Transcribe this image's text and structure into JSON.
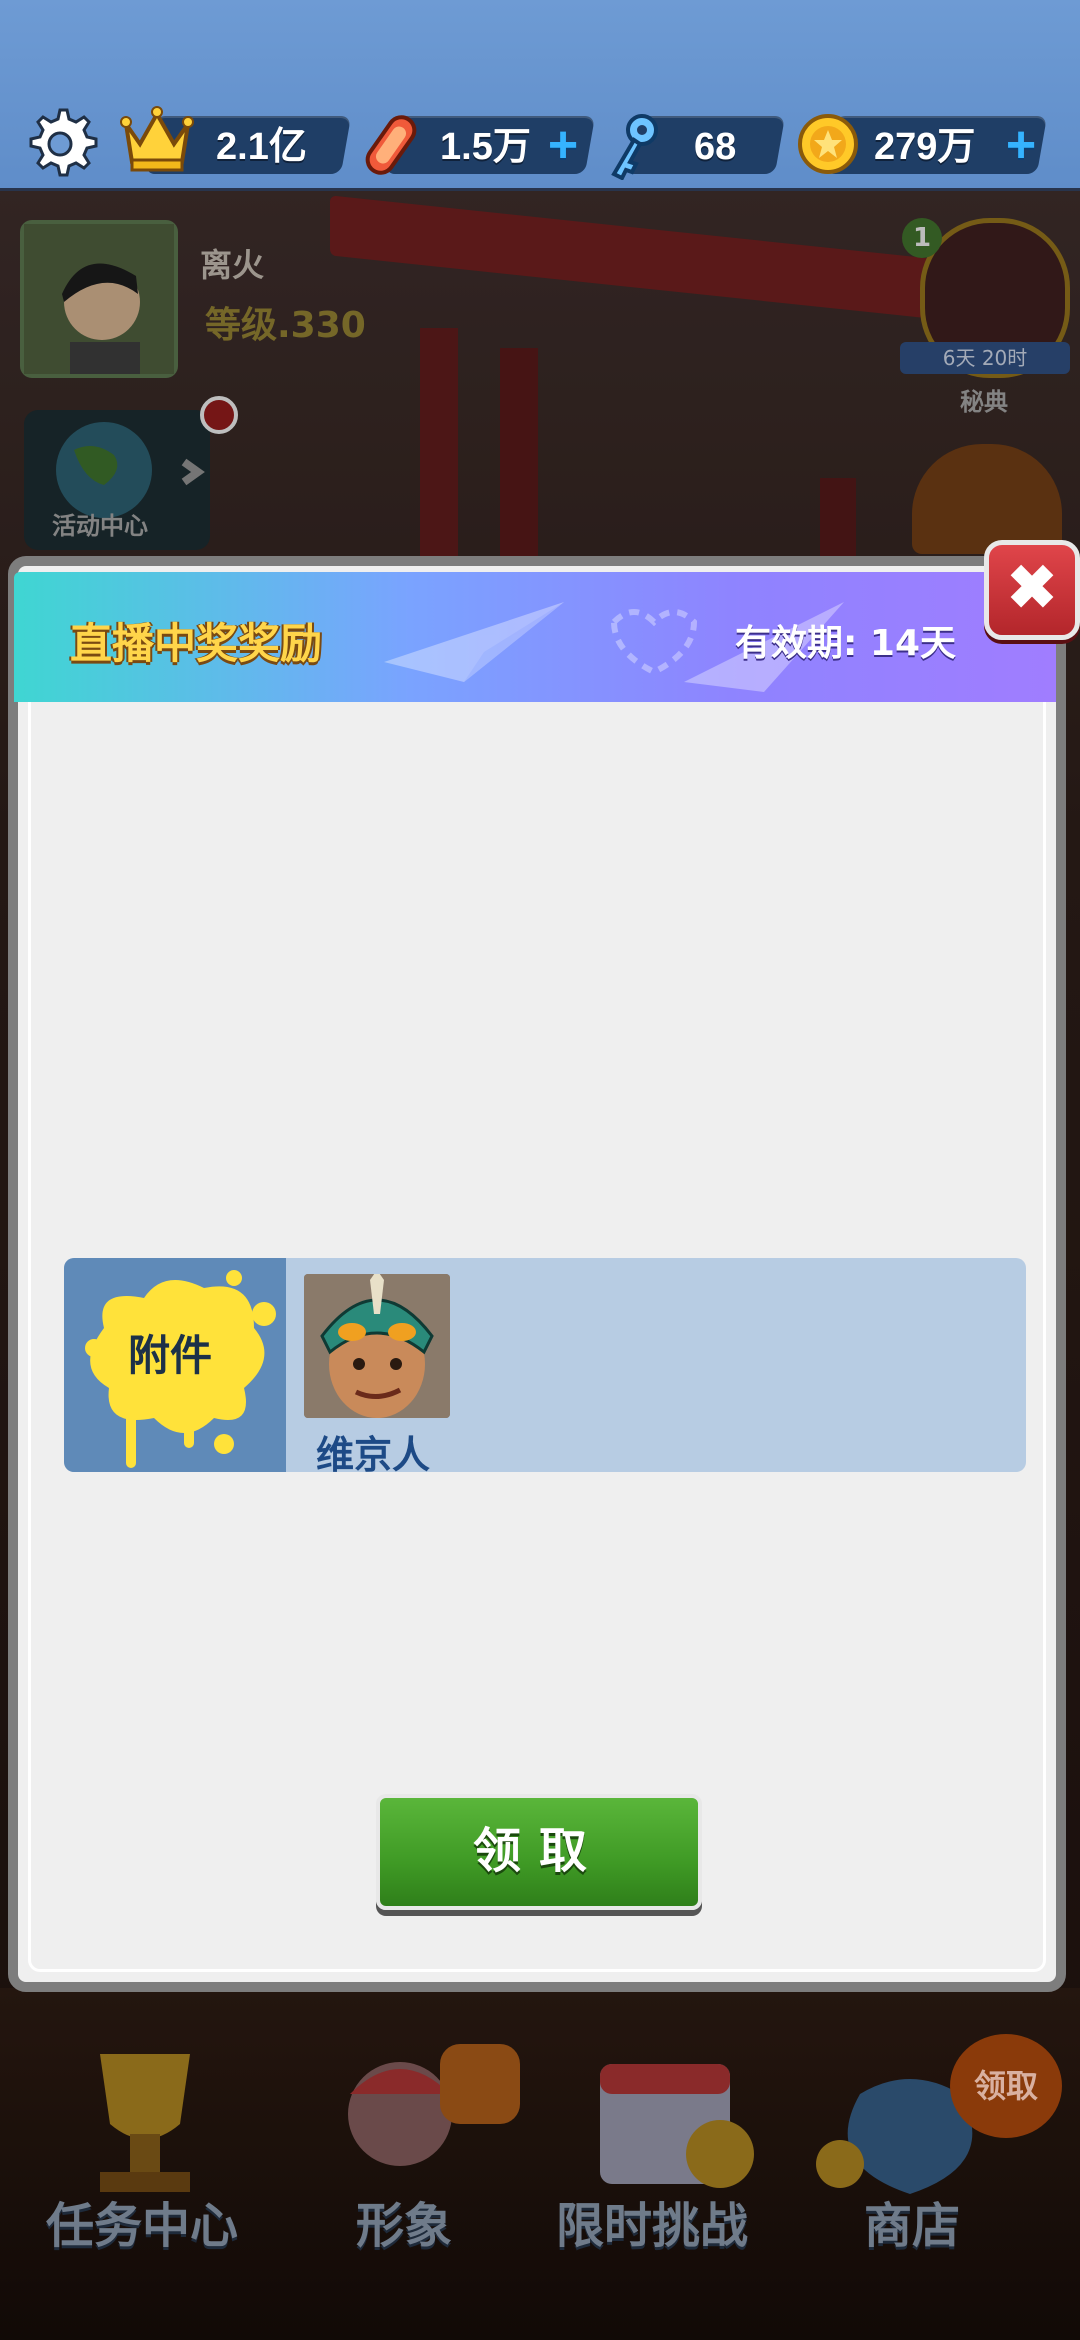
{
  "topbar": {
    "crown_value": "2.1亿",
    "ticket_value": "1.5万",
    "key_value": "68",
    "coin_value": "279万",
    "icons": [
      "gear-icon",
      "crown-icon",
      "hoverboard-icon",
      "key-icon",
      "coin-icon",
      "plus-icon"
    ]
  },
  "player": {
    "name": "离火",
    "level": "等级.330"
  },
  "event_center": {
    "label": "活动中心"
  },
  "side_right": {
    "badge": "1",
    "timer": "6天 20时",
    "label": "秘典"
  },
  "modal": {
    "title": "直播中奖奖励",
    "validity": "有效期: 14天",
    "close_icon": "close-x-icon",
    "attachment_label": "附件",
    "item_name": "维京人",
    "claim_label": "领取"
  },
  "bottom_nav": {
    "items": [
      {
        "label": "任务中心"
      },
      {
        "label": "形象"
      },
      {
        "label": "限时挑战"
      },
      {
        "label": "商店"
      }
    ],
    "claim_badge": "领取"
  },
  "colors": {
    "topbar_bg": "#6e9bd4",
    "header_gradient_start": "#3fd6d2",
    "header_gradient_end": "#a07dff",
    "title_gold": "#ffd54a",
    "claim_green": "#3f9a25",
    "close_red": "#c93036",
    "reward_row_bg": "#b7cce3",
    "reward_tag_bg": "#5f8ab8"
  }
}
